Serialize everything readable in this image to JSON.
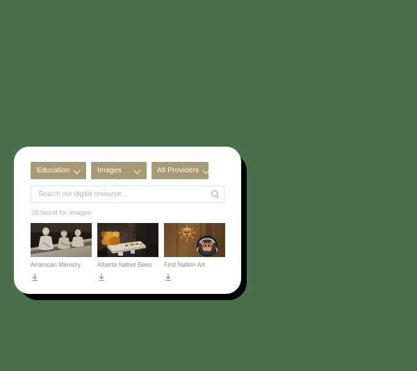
{
  "background_color": "#4a704b",
  "widget": {
    "accent_color": "#a89a74",
    "card_background": "#ffffff",
    "shadow_color": "#000000",
    "filters": [
      {
        "name": "category",
        "label": "Education",
        "icon": "chevron-down-icon"
      },
      {
        "name": "type",
        "label": "Images",
        "icon": "chevron-down-icon"
      },
      {
        "name": "provider",
        "label": "All Providers",
        "icon": "chevron-down-icon"
      }
    ],
    "search": {
      "placeholder": "Search our digital resource...",
      "value": "",
      "icon": "search-icon"
    },
    "results_count": "25 found for Images",
    "results": [
      {
        "title": "American Memory",
        "thumbnail": "sepia-photo-people-at-table",
        "download_icon": "download-icon"
      },
      {
        "title": "Alberta Native Bees",
        "thumbnail": "dark-photo-bees-on-tray",
        "download_icon": "download-icon"
      },
      {
        "title": "First Nation Art",
        "thumbnail": "carved-wooden-masks",
        "download_icon": "download-icon"
      }
    ]
  }
}
